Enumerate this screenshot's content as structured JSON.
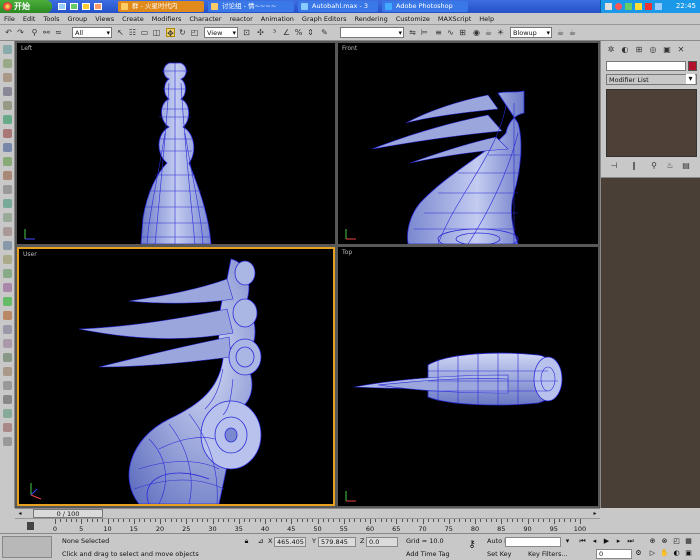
{
  "taskbar": {
    "start_label": "开始",
    "tasks": [
      {
        "label": "群 - 火星时代内",
        "active": true
      },
      {
        "label": "讨论组 - 情~~~~",
        "active": false
      },
      {
        "label": "Autobahl.max - 3",
        "active": false
      },
      {
        "label": "Adobe Photoshop",
        "active": false
      }
    ],
    "clock": "22:45"
  },
  "menubar": {
    "items": [
      "File",
      "Edit",
      "Tools",
      "Group",
      "Views",
      "Create",
      "Modifiers",
      "Character",
      "reactor",
      "Animation",
      "Graph Editors",
      "Rendering",
      "Customize",
      "MAXScript",
      "Help"
    ]
  },
  "toolbar": {
    "selection_filter": "All",
    "ref_coord": "View",
    "named_selection": "",
    "render_type": "Blowup"
  },
  "viewports": {
    "left_label": "Left",
    "front_label": "Front",
    "user_label": "User",
    "top_label": "Top"
  },
  "command_panel": {
    "name_value": "",
    "modifier_list": "Modifier List",
    "swatch_color": "#b0102c"
  },
  "timeslider": {
    "position": "0 / 100"
  },
  "trackbar": {
    "ticks": [
      "0",
      "5",
      "10",
      "15",
      "20",
      "25",
      "30",
      "35",
      "40",
      "45",
      "50",
      "55",
      "60",
      "65",
      "70",
      "75",
      "80",
      "85",
      "90",
      "95",
      "100"
    ]
  },
  "status": {
    "selection": "None Selected",
    "prompt": "Click and drag to select and move objects",
    "x_label": "X",
    "x_value": "465.405",
    "y_label": "Y",
    "y_value": "579.845",
    "z_label": "Z",
    "z_value": "0.0",
    "grid": "Grid = 10.0",
    "add_time_tag": "Add Time Tag",
    "auto_key": "Auto Key",
    "set_key": "Set Key",
    "key_filters": "Key Filters...",
    "frame": "0"
  },
  "colors": {
    "active_viewport_border": "#e8a020",
    "mesh_fill": "#aab6e4",
    "mesh_wire": "#2a2ad8"
  }
}
